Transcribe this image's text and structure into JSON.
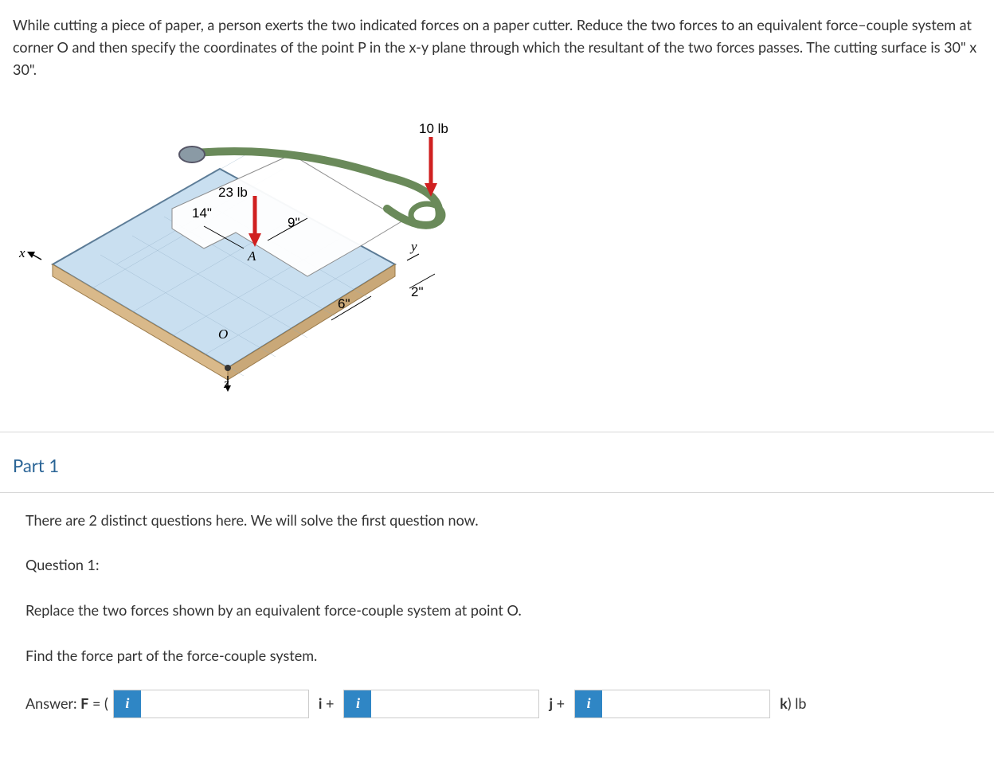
{
  "problem": {
    "text": "While cutting a piece of paper, a person exerts the two indicated forces on a paper cutter. Reduce the two forces to an equivalent force–couple system at corner O and then specify the coordinates of the point P in the x-y plane through which the resultant of the two forces passes. The cutting surface is 30\" x 30\"."
  },
  "figure": {
    "force1_label": "10 lb",
    "force2_label": "23 lb",
    "dim_14": "14\"",
    "dim_9": "9\"",
    "dim_6": "6\"",
    "dim_2": "2\"",
    "axis_x": "x",
    "axis_y": "y",
    "axis_z": "z",
    "pointA": "A",
    "pointO": "O"
  },
  "part1": {
    "heading": "Part 1",
    "intro": "There are 2 distinct questions here. We will solve the first question now.",
    "q_label": "Question 1:",
    "q_text": "Replace the two forces shown by an equivalent force-couple system at point O.",
    "q_sub": "Find the force part of the force-couple system.",
    "answer_prefix": "Answer: F = (",
    "sep_i": "i +",
    "sep_j": "j +",
    "suffix": "k) lb",
    "info_icon": "i"
  }
}
